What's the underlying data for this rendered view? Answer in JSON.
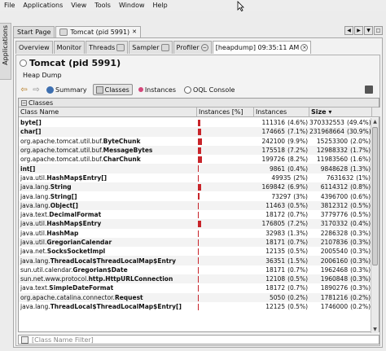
{
  "menubar": {
    "items": [
      "File",
      "Applications",
      "View",
      "Tools",
      "Window",
      "Help"
    ]
  },
  "sidebar": {
    "label": "Applications"
  },
  "outer_tabs": [
    {
      "label": "Start Page"
    },
    {
      "label": "Tomcat (pid 5991)"
    }
  ],
  "inner_tabs": [
    {
      "label": "Overview"
    },
    {
      "label": "Monitor"
    },
    {
      "label": "Threads"
    },
    {
      "label": "Sampler"
    },
    {
      "label": "Profiler"
    },
    {
      "label": "[heapdump] 09:35:11 AM"
    }
  ],
  "page": {
    "title": "Tomcat (pid 5991)",
    "subtitle": "Heap Dump"
  },
  "toolbar": {
    "summary": "Summary",
    "classes": "Classes",
    "instances": "Instances",
    "oql": "OQL Console"
  },
  "classes": {
    "section_label": "Classes",
    "columns": {
      "name": "Class Name",
      "bar": "Instances [%]",
      "instances": "Instances",
      "size": "Size"
    },
    "rows": [
      {
        "prefix": "",
        "name": "byte[]",
        "instances": "111316",
        "ipct": "(4.6%)",
        "size": "370332553",
        "spct": "(49.4%)",
        "pct": 4.6
      },
      {
        "prefix": "",
        "name": "char[]",
        "instances": "174665",
        "ipct": "(7.1%)",
        "size": "231968664",
        "spct": "(30.9%)",
        "pct": 7.1
      },
      {
        "prefix": "org.apache.tomcat.util.buf.",
        "name": "ByteChunk",
        "instances": "242100",
        "ipct": "(9.9%)",
        "size": "15253300",
        "spct": "(2.0%)",
        "pct": 9.9
      },
      {
        "prefix": "org.apache.tomcat.util.buf.",
        "name": "MessageBytes",
        "instances": "175518",
        "ipct": "(7.2%)",
        "size": "12988332",
        "spct": "(1.7%)",
        "pct": 7.2
      },
      {
        "prefix": "org.apache.tomcat.util.buf.",
        "name": "CharChunk",
        "instances": "199726",
        "ipct": "(8.2%)",
        "size": "11983560",
        "spct": "(1.6%)",
        "pct": 8.2
      },
      {
        "prefix": "",
        "name": "int[]",
        "instances": "9861",
        "ipct": "(0.4%)",
        "size": "9848628",
        "spct": "(1.3%)",
        "pct": 0.4
      },
      {
        "prefix": "java.util.",
        "name": "HashMap$Entry[]",
        "instances": "49935",
        "ipct": "(2%)",
        "size": "7631632",
        "spct": "(1%)",
        "pct": 2.0
      },
      {
        "prefix": "java.lang.",
        "name": "String",
        "instances": "169842",
        "ipct": "(6.9%)",
        "size": "6114312",
        "spct": "(0.8%)",
        "pct": 6.9
      },
      {
        "prefix": "java.lang.",
        "name": "String[]",
        "instances": "73297",
        "ipct": "(3%)",
        "size": "4396700",
        "spct": "(0.6%)",
        "pct": 3.0
      },
      {
        "prefix": "java.lang.",
        "name": "Object[]",
        "instances": "11463",
        "ipct": "(0.5%)",
        "size": "3812312",
        "spct": "(0.5%)",
        "pct": 0.5
      },
      {
        "prefix": "java.text.",
        "name": "DecimalFormat",
        "instances": "18172",
        "ipct": "(0.7%)",
        "size": "3779776",
        "spct": "(0.5%)",
        "pct": 0.7
      },
      {
        "prefix": "java.util.",
        "name": "HashMap$Entry",
        "instances": "176805",
        "ipct": "(7.2%)",
        "size": "3170332",
        "spct": "(0.4%)",
        "pct": 7.2
      },
      {
        "prefix": "java.util.",
        "name": "HashMap",
        "instances": "32983",
        "ipct": "(1.3%)",
        "size": "2286328",
        "spct": "(0.3%)",
        "pct": 1.3
      },
      {
        "prefix": "java.util.",
        "name": "GregorianCalendar",
        "instances": "18171",
        "ipct": "(0.7%)",
        "size": "2107836",
        "spct": "(0.3%)",
        "pct": 0.7
      },
      {
        "prefix": "java.net.",
        "name": "SocksSocketImpl",
        "instances": "12135",
        "ipct": "(0.5%)",
        "size": "2005540",
        "spct": "(0.3%)",
        "pct": 0.5
      },
      {
        "prefix": "java.lang.",
        "name": "ThreadLocal$ThreadLocalMap$Entry",
        "instances": "36351",
        "ipct": "(1.5%)",
        "size": "2006160",
        "spct": "(0.3%)",
        "pct": 1.5
      },
      {
        "prefix": "sun.util.calendar.",
        "name": "Gregorian$Date",
        "instances": "18171",
        "ipct": "(0.7%)",
        "size": "1962468",
        "spct": "(0.3%)",
        "pct": 0.7
      },
      {
        "prefix": "sun.net.www.protocol.",
        "name": "http.HttpURLConnection",
        "instances": "12108",
        "ipct": "(0.5%)",
        "size": "1960848",
        "spct": "(0.3%)",
        "pct": 0.5
      },
      {
        "prefix": "java.text.",
        "name": "SimpleDateFormat",
        "instances": "18172",
        "ipct": "(0.7%)",
        "size": "1890276",
        "spct": "(0.3%)",
        "pct": 0.7
      },
      {
        "prefix": "org.apache.catalina.connector.",
        "name": "Request",
        "instances": "5050",
        "ipct": "(0.2%)",
        "size": "1781216",
        "spct": "(0.2%)",
        "pct": 0.2
      },
      {
        "prefix": "java.lang.",
        "name": "ThreadLocal$ThreadLocalMap$Entry[]",
        "instances": "12125",
        "ipct": "(0.5%)",
        "size": "1746000",
        "spct": "(0.2%)",
        "pct": 0.5
      }
    ]
  },
  "filter": {
    "placeholder": "[Class Name Filter]"
  },
  "colors": {
    "bar": "#c8242a"
  }
}
